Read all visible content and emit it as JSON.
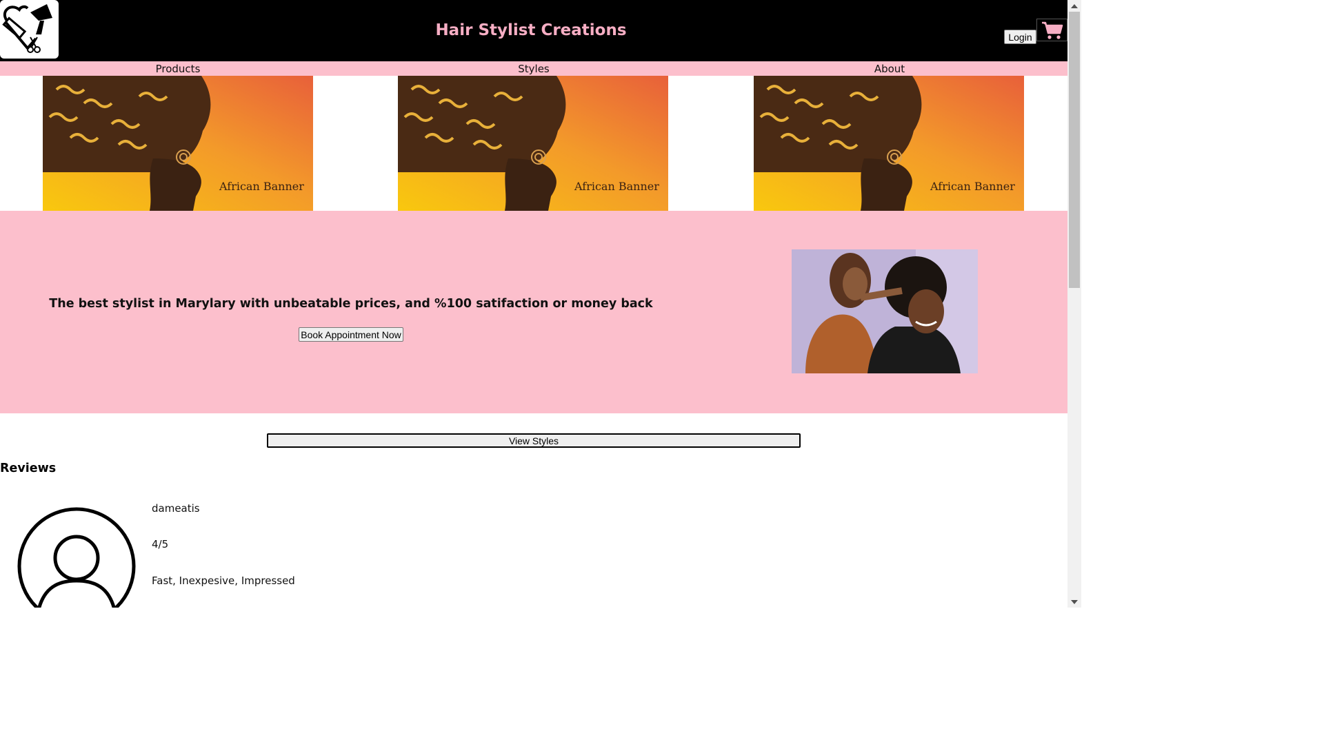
{
  "header": {
    "title": "Hair Stylist Creations",
    "login_label": "Login",
    "logo_icon": "heart-comb-dryer-logo",
    "cart_icon": "shopping-cart-icon",
    "title_color": "#f7aec4"
  },
  "nav": {
    "items": [
      {
        "label": "Products"
      },
      {
        "label": "Styles"
      },
      {
        "label": "About"
      }
    ]
  },
  "banners": [
    {
      "text": "African Banner"
    },
    {
      "text": "African Banner"
    },
    {
      "text": "African Banner"
    }
  ],
  "hero": {
    "tagline": "The best stylist in Marylary with unbeatable prices, and %100 satifaction or money back",
    "book_label": "Book Appointment Now",
    "background": "#fcbfcc"
  },
  "view_styles_label": "View Styles",
  "reviews": {
    "title": "Reviews",
    "items": [
      {
        "user": "dameatis",
        "rating": "4/5",
        "comment": "Fast, Inexpesive, Impressed"
      }
    ]
  }
}
